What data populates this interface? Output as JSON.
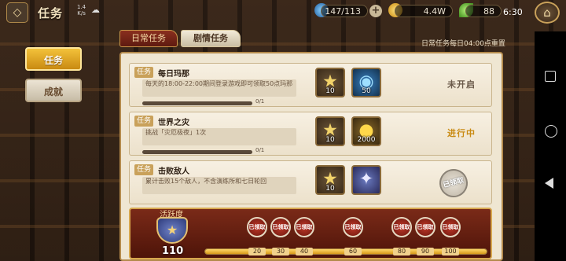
{
  "header": {
    "title": "任务",
    "net_speed": "1.4",
    "net_unit": "K/s",
    "stamina": "147/113",
    "gold": "4.4W",
    "gem": "88",
    "clock": "6:30"
  },
  "tabs": [
    {
      "label": "日常任务",
      "active": false
    },
    {
      "label": "剧情任务",
      "active": true
    }
  ],
  "reset_note": "日常任务每日04:00点重置",
  "side": {
    "task_label": "任务",
    "achievement_label": "成就"
  },
  "tasks": [
    {
      "badge": "任务",
      "name": "每日玛那",
      "desc": "每天的18:00-22:00期间登录游戏即可领取50点玛那",
      "progress_text": "0/1",
      "progress": 0,
      "rewards": [
        {
          "icon": "star-medal-icon",
          "count": "10"
        },
        {
          "icon": "mana-orb-icon",
          "count": "50"
        }
      ],
      "status": "未开启"
    },
    {
      "badge": "任务",
      "name": "世界之灾",
      "desc": "挑战「灾厄极夜」1次",
      "progress_text": "0/1",
      "progress": 0,
      "rewards": [
        {
          "icon": "star-medal-icon",
          "count": "10"
        },
        {
          "icon": "gold-coin-icon",
          "count": "2000"
        }
      ],
      "status": "进行中"
    },
    {
      "badge": "任务",
      "name": "击败敌人",
      "desc": "累计击败15个敌人，不含演练所和七日轮回",
      "progress_text": "",
      "progress": 1,
      "rewards": [
        {
          "icon": "star-medal-icon",
          "count": "10"
        },
        {
          "icon": "key-item-icon",
          "count": ""
        }
      ],
      "status": "已领取"
    }
  ],
  "activity": {
    "label": "活跃度",
    "value": "110",
    "fill_fraction": 1,
    "milestones": [
      "20",
      "30",
      "40",
      "60",
      "80",
      "90",
      "100"
    ],
    "chest_label": "已领取"
  },
  "colors": {
    "accent_gold": "#c9a15a",
    "active_status": "#c98a12",
    "tab_red": "#8a2f1e"
  }
}
